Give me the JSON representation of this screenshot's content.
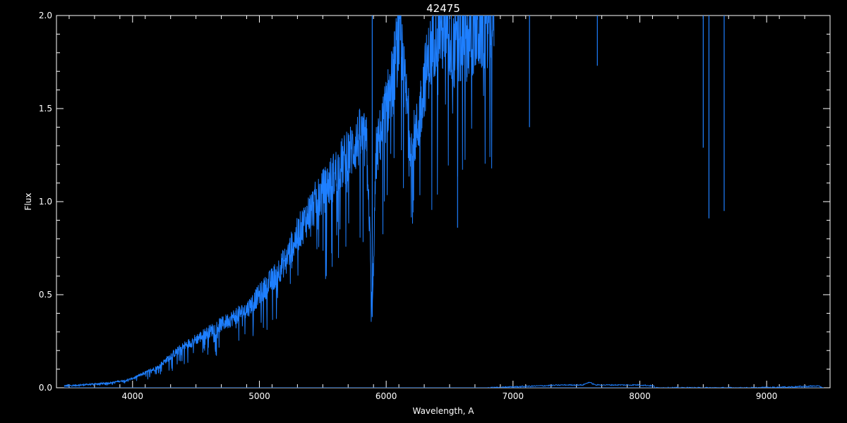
{
  "chart_data": {
    "type": "line",
    "title": "42475",
    "xlabel": "Wavelength, A",
    "ylabel": "Flux",
    "xlim": [
      3400,
      9500
    ],
    "ylim": [
      0,
      2.0
    ],
    "x_ticks": [
      4000,
      5000,
      6000,
      7000,
      8000,
      9000
    ],
    "x_tick_labels": [
      "4000",
      "5000",
      "6000",
      "7000",
      "8000",
      "9000"
    ],
    "y_ticks": [
      0.0,
      0.5,
      1.0,
      1.5,
      2.0
    ],
    "y_tick_labels": [
      "0.0",
      "0.5",
      "1.0",
      "1.5",
      "2.0"
    ],
    "grid": false,
    "background_color": "#000000",
    "axis_color": "#ffffff",
    "series": [
      {
        "color": "#1e7fff",
        "x": [
          3460,
          3600,
          3800,
          3950,
          4000,
          4100,
          4200,
          4300,
          4400,
          4500,
          4600,
          4700,
          4800,
          4900,
          5000,
          5100,
          5200,
          5300,
          5400,
          5500,
          5600,
          5700,
          5800,
          5850,
          5890,
          5920,
          6000,
          6050,
          6100,
          6150,
          6200,
          6250,
          6300,
          6350,
          6400,
          6450,
          6500,
          6550,
          6600,
          6700,
          6800,
          6850
        ],
        "y": [
          0.01,
          0.015,
          0.025,
          0.04,
          0.05,
          0.08,
          0.11,
          0.17,
          0.22,
          0.26,
          0.3,
          0.34,
          0.38,
          0.42,
          0.5,
          0.58,
          0.68,
          0.82,
          0.95,
          1.05,
          1.15,
          1.25,
          1.35,
          1.3,
          0.38,
          1.25,
          1.5,
          1.65,
          1.9,
          1.6,
          1.3,
          1.4,
          1.65,
          1.8,
          1.95,
          1.9,
          1.85,
          1.8,
          1.85,
          1.9,
          1.95,
          2.0
        ],
        "absorption_lines": [
          {
            "x": 5890,
            "y": 0.38
          },
          {
            "x": 6563,
            "y": 0.86
          },
          {
            "x": 7130,
            "y": 1.4
          },
          {
            "x": 7665,
            "y": 1.73
          },
          {
            "x": 8500,
            "y": 1.29
          },
          {
            "x": 8545,
            "y": 0.91
          },
          {
            "x": 8665,
            "y": 0.95
          }
        ]
      },
      {
        "color": "#1e7fff",
        "x": [
          6800,
          7000,
          7200,
          7400,
          7550,
          7600,
          7650,
          7800,
          8000,
          8110,
          8120,
          8300,
          8600,
          8900,
          9200,
          9400,
          9450
        ],
        "y": [
          0.0,
          0.005,
          0.01,
          0.015,
          0.015,
          0.03,
          0.015,
          0.015,
          0.015,
          0.01,
          0.0,
          0.0,
          0.0,
          0.0,
          0.005,
          0.01,
          0.0
        ]
      }
    ]
  }
}
